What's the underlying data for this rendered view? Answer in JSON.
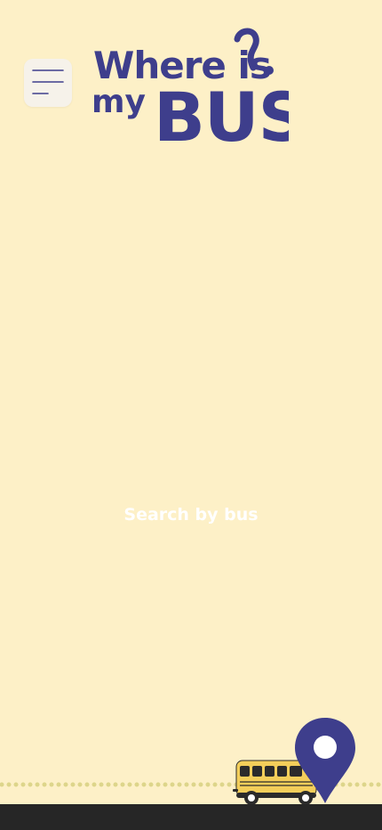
{
  "header": {
    "menu_icon": "hamburger-menu-icon",
    "logo": {
      "line1": "Where is",
      "line2_small": "my",
      "line2_big": "BUS",
      "color": "#3E3E8C",
      "glyph": "question-mark"
    }
  },
  "main": {
    "search_button_label": "Search by bus"
  },
  "footer": {
    "bus_icon": "school-bus-icon",
    "pin_icon": "location-pin-icon"
  },
  "colors": {
    "background": "#FDF0C7",
    "brand": "#3E3E8C",
    "bus_yellow": "#F3CE5A",
    "road_dots": "#DDD58A",
    "bottom_bar": "#262626"
  }
}
